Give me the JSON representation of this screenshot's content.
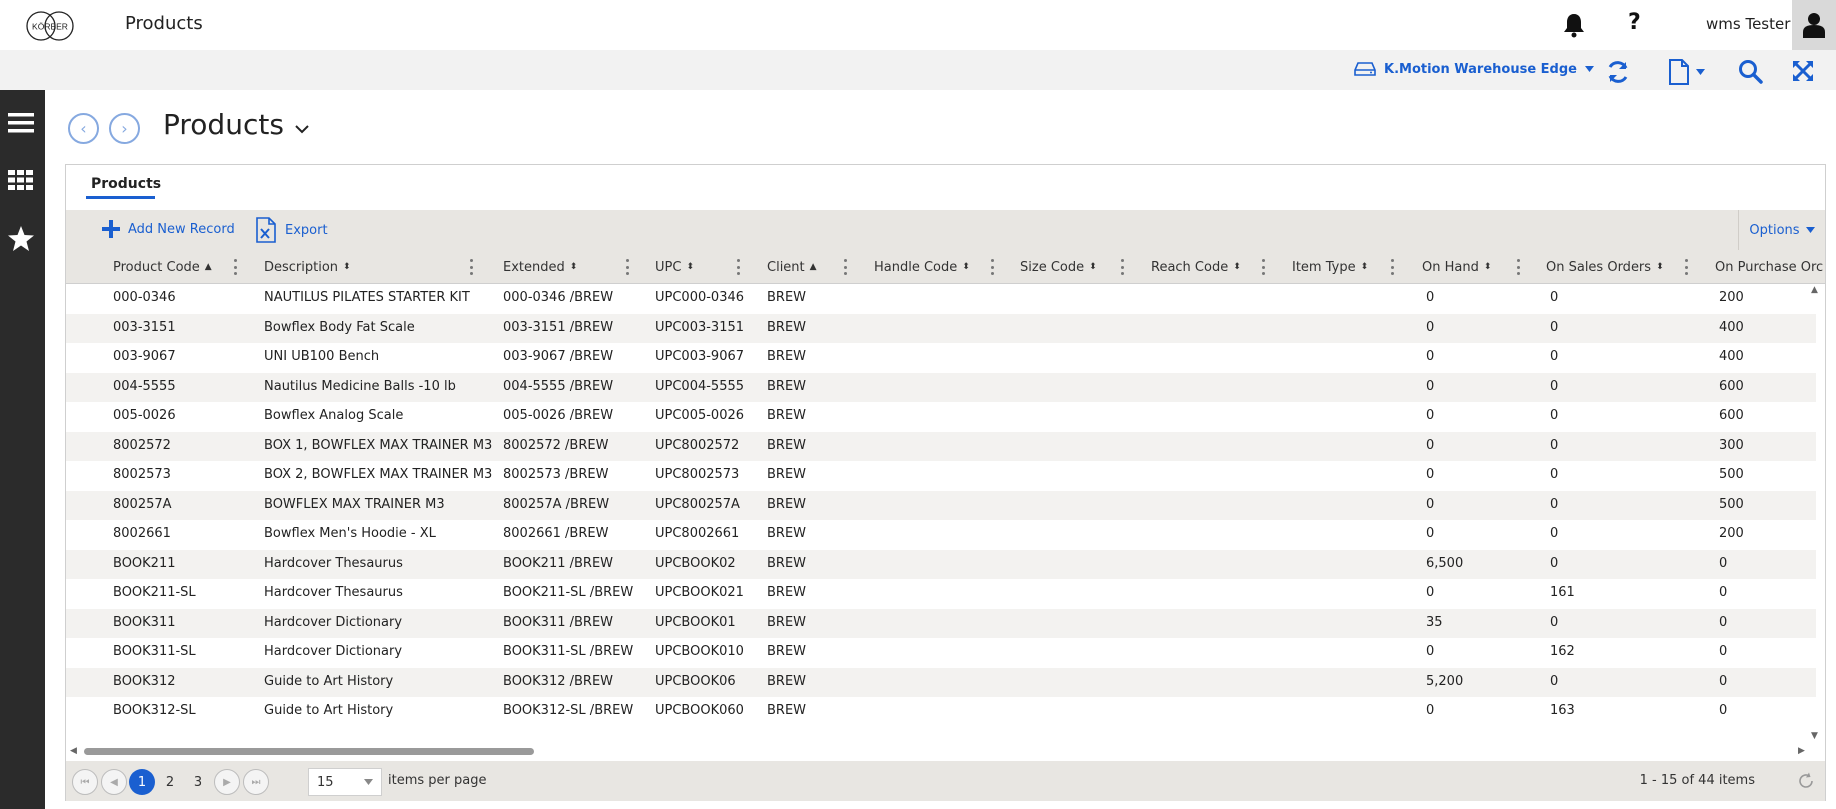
{
  "header": {
    "logo_text": "KÖRBER",
    "app_title": "Products",
    "user_name": "wms Tester",
    "help_label": "?"
  },
  "toolbar_band": {
    "warehouse": "K.Motion Warehouse Edge"
  },
  "page": {
    "title": "Products",
    "back_glyph": "‹",
    "forward_glyph": "›"
  },
  "tabs": [
    {
      "label": "Products"
    }
  ],
  "grid_toolbar": {
    "add_label": "Add New Record",
    "export_label": "Export",
    "options_label": "Options"
  },
  "columns": [
    {
      "label": "Product Code",
      "sort": "▲"
    },
    {
      "label": "Description",
      "sort": "⬍"
    },
    {
      "label": "Extended",
      "sort": "⬍"
    },
    {
      "label": "UPC",
      "sort": "⬍"
    },
    {
      "label": "Client",
      "sort": "▲"
    },
    {
      "label": "Handle Code",
      "sort": "⬍"
    },
    {
      "label": "Size Code",
      "sort": "⬍"
    },
    {
      "label": "Reach Code",
      "sort": "⬍"
    },
    {
      "label": "Item Type",
      "sort": "⬍"
    },
    {
      "label": "On Hand",
      "sort": "⬍"
    },
    {
      "label": "On Sales Orders",
      "sort": "⬍"
    },
    {
      "label": "On Purchase Orc",
      "sort": ""
    }
  ],
  "rows": [
    [
      "000-0346",
      "NAUTILUS PILATES STARTER KIT",
      "000-0346 /BREW",
      "UPC000-0346",
      "BREW",
      "",
      "",
      "",
      "",
      "0",
      "0",
      "200"
    ],
    [
      "003-3151",
      "Bowflex Body Fat Scale",
      "003-3151 /BREW",
      "UPC003-3151",
      "BREW",
      "",
      "",
      "",
      "",
      "0",
      "0",
      "400"
    ],
    [
      "003-9067",
      "UNI UB100 Bench",
      "003-9067 /BREW",
      "UPC003-9067",
      "BREW",
      "",
      "",
      "",
      "",
      "0",
      "0",
      "400"
    ],
    [
      "004-5555",
      "Nautilus Medicine Balls -10 lb",
      "004-5555 /BREW",
      "UPC004-5555",
      "BREW",
      "",
      "",
      "",
      "",
      "0",
      "0",
      "600"
    ],
    [
      "005-0026",
      "Bowflex Analog Scale",
      "005-0026 /BREW",
      "UPC005-0026",
      "BREW",
      "",
      "",
      "",
      "",
      "0",
      "0",
      "600"
    ],
    [
      "8002572",
      "BOX 1, BOWFLEX MAX TRAINER M3",
      "8002572 /BREW",
      "UPC8002572",
      "BREW",
      "",
      "",
      "",
      "",
      "0",
      "0",
      "300"
    ],
    [
      "8002573",
      "BOX 2, BOWFLEX MAX TRAINER M3",
      "8002573 /BREW",
      "UPC8002573",
      "BREW",
      "",
      "",
      "",
      "",
      "0",
      "0",
      "500"
    ],
    [
      "800257A",
      "BOWFLEX MAX TRAINER M3",
      "800257A /BREW",
      "UPC800257A",
      "BREW",
      "",
      "",
      "",
      "",
      "0",
      "0",
      "500"
    ],
    [
      "8002661",
      "Bowflex Men's Hoodie - XL",
      "8002661 /BREW",
      "UPC8002661",
      "BREW",
      "",
      "",
      "",
      "",
      "0",
      "0",
      "200"
    ],
    [
      "BOOK211",
      "Hardcover Thesaurus",
      "BOOK211 /BREW",
      "UPCBOOK02",
      "BREW",
      "",
      "",
      "",
      "",
      "6,500",
      "0",
      "0"
    ],
    [
      "BOOK211-SL",
      "Hardcover Thesaurus",
      "BOOK211-SL /BREW",
      "UPCBOOK021",
      "BREW",
      "",
      "",
      "",
      "",
      "0",
      "161",
      "0"
    ],
    [
      "BOOK311",
      "Hardcover Dictionary",
      "BOOK311 /BREW",
      "UPCBOOK01",
      "BREW",
      "",
      "",
      "",
      "",
      "35",
      "0",
      "0"
    ],
    [
      "BOOK311-SL",
      "Hardcover Dictionary",
      "BOOK311-SL /BREW",
      "UPCBOOK010",
      "BREW",
      "",
      "",
      "",
      "",
      "0",
      "162",
      "0"
    ],
    [
      "BOOK312",
      "Guide to Art History",
      "BOOK312 /BREW",
      "UPCBOOK06",
      "BREW",
      "",
      "",
      "",
      "",
      "5,200",
      "0",
      "0"
    ],
    [
      "BOOK312-SL",
      "Guide to Art History",
      "BOOK312-SL /BREW",
      "UPCBOOK060",
      "BREW",
      "",
      "",
      "",
      "",
      "0",
      "163",
      "0"
    ]
  ],
  "pager": {
    "pages": [
      "1",
      "2",
      "3"
    ],
    "current": "1",
    "per_page": "15",
    "per_page_label": "items per page",
    "range": "1 - 15 of 44 items"
  },
  "colors": {
    "accent": "#1a5fd0",
    "rail": "#2b2b2b",
    "header_band": "#e8e6e2"
  }
}
